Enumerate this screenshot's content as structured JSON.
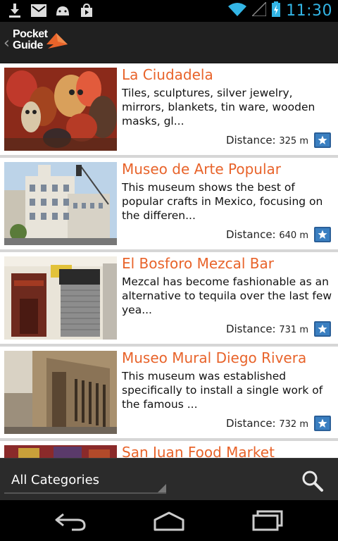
{
  "status_bar": {
    "time": "11:30",
    "icons": [
      "download-icon",
      "gmail-icon",
      "android-icon",
      "shopping-bag-icon",
      "wifi-icon",
      "signal-icon",
      "battery-icon"
    ]
  },
  "app": {
    "logo_line1": "Pocket",
    "logo_line2": "Guide",
    "accent_color": "#e8632a"
  },
  "places": [
    {
      "title": "La Ciudadela",
      "description": "Tiles, sculptures, silver jewelry, mirrors, blankets, tin ware, wooden masks, gl...",
      "distance_label": "Distance:",
      "distance_value": "325 m"
    },
    {
      "title": "Museo de Arte Popular",
      "description": "This museum shows the best of popular crafts in Mexico, focusing on the differen...",
      "distance_label": "Distance:",
      "distance_value": "640 m"
    },
    {
      "title": "El Bosforo Mezcal Bar",
      "description": "Mezcal has become fashionable as an alternative to tequila over the last few yea...",
      "distance_label": "Distance:",
      "distance_value": "731 m"
    },
    {
      "title": "Museo Mural Diego Rivera",
      "description": "This museum was established specifically to install a single work of the famous ...",
      "distance_label": "Distance:",
      "distance_value": "732 m"
    },
    {
      "title": "San Juan Food Market"
    }
  ],
  "category_filter": {
    "selected": "All Categories"
  }
}
